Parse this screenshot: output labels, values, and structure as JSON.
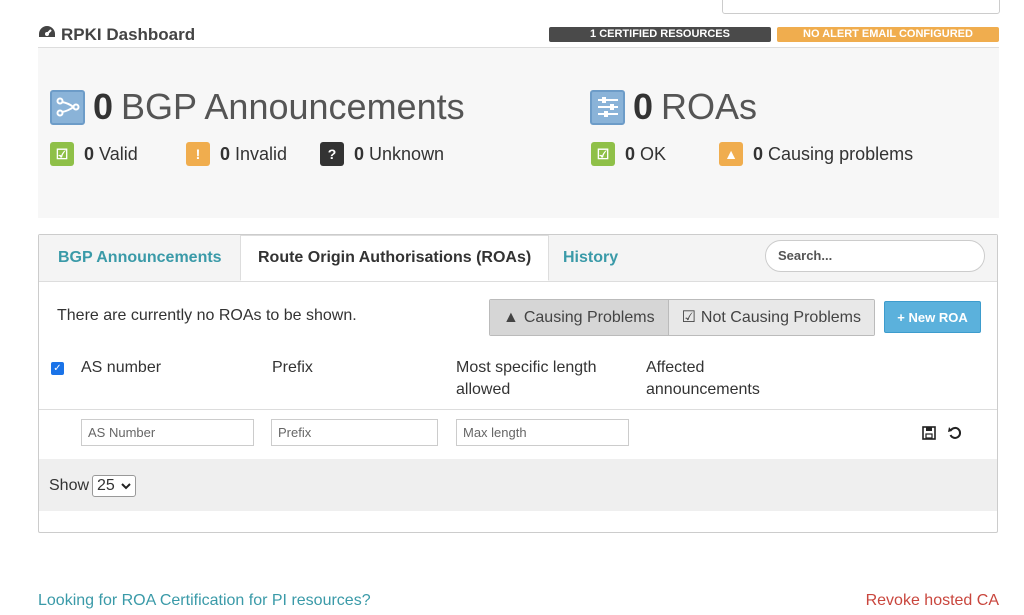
{
  "header": {
    "title": "RPKI Dashboard",
    "badge_certified": "1 CERTIFIED RESOURCES",
    "badge_alert": "NO ALERT EMAIL CONFIGURED"
  },
  "summary": {
    "bgp": {
      "count": "0",
      "label": "BGP Announcements"
    },
    "roas": {
      "count": "0",
      "label": "ROAs"
    },
    "valid": {
      "count": "0",
      "label": "Valid"
    },
    "invalid": {
      "count": "0",
      "label": "Invalid"
    },
    "unknown": {
      "count": "0",
      "label": "Unknown"
    },
    "ok": {
      "count": "0",
      "label": "OK"
    },
    "causing": {
      "count": "0",
      "label": "Causing problems"
    }
  },
  "tabs": [
    {
      "label": "BGP Announcements"
    },
    {
      "label": "Route Origin Authorisations (ROAs)"
    },
    {
      "label": "History"
    }
  ],
  "search": {
    "placeholder": "Search..."
  },
  "roa_panel": {
    "message": "There are currently no ROAs to be shown.",
    "filter_causing": "Causing Problems",
    "filter_not_causing": "Not Causing Problems",
    "new_roa": "+ New ROA",
    "columns": [
      "AS number",
      "Prefix",
      "Most specific length allowed",
      "Affected announcements"
    ],
    "inputs": {
      "as_number": "AS Number",
      "prefix": "Prefix",
      "max_length": "Max length"
    },
    "show_label": "Show",
    "page_size": "25"
  },
  "links": {
    "pi_resources": "Looking for ROA Certification for PI resources?",
    "revoke": "Revoke hosted CA"
  },
  "colors": {
    "accent": "#3a9aa8",
    "green": "#8fc048",
    "orange": "#f0ad4e",
    "blue_button": "#5bb1dc",
    "revoke": "#c9463d"
  }
}
